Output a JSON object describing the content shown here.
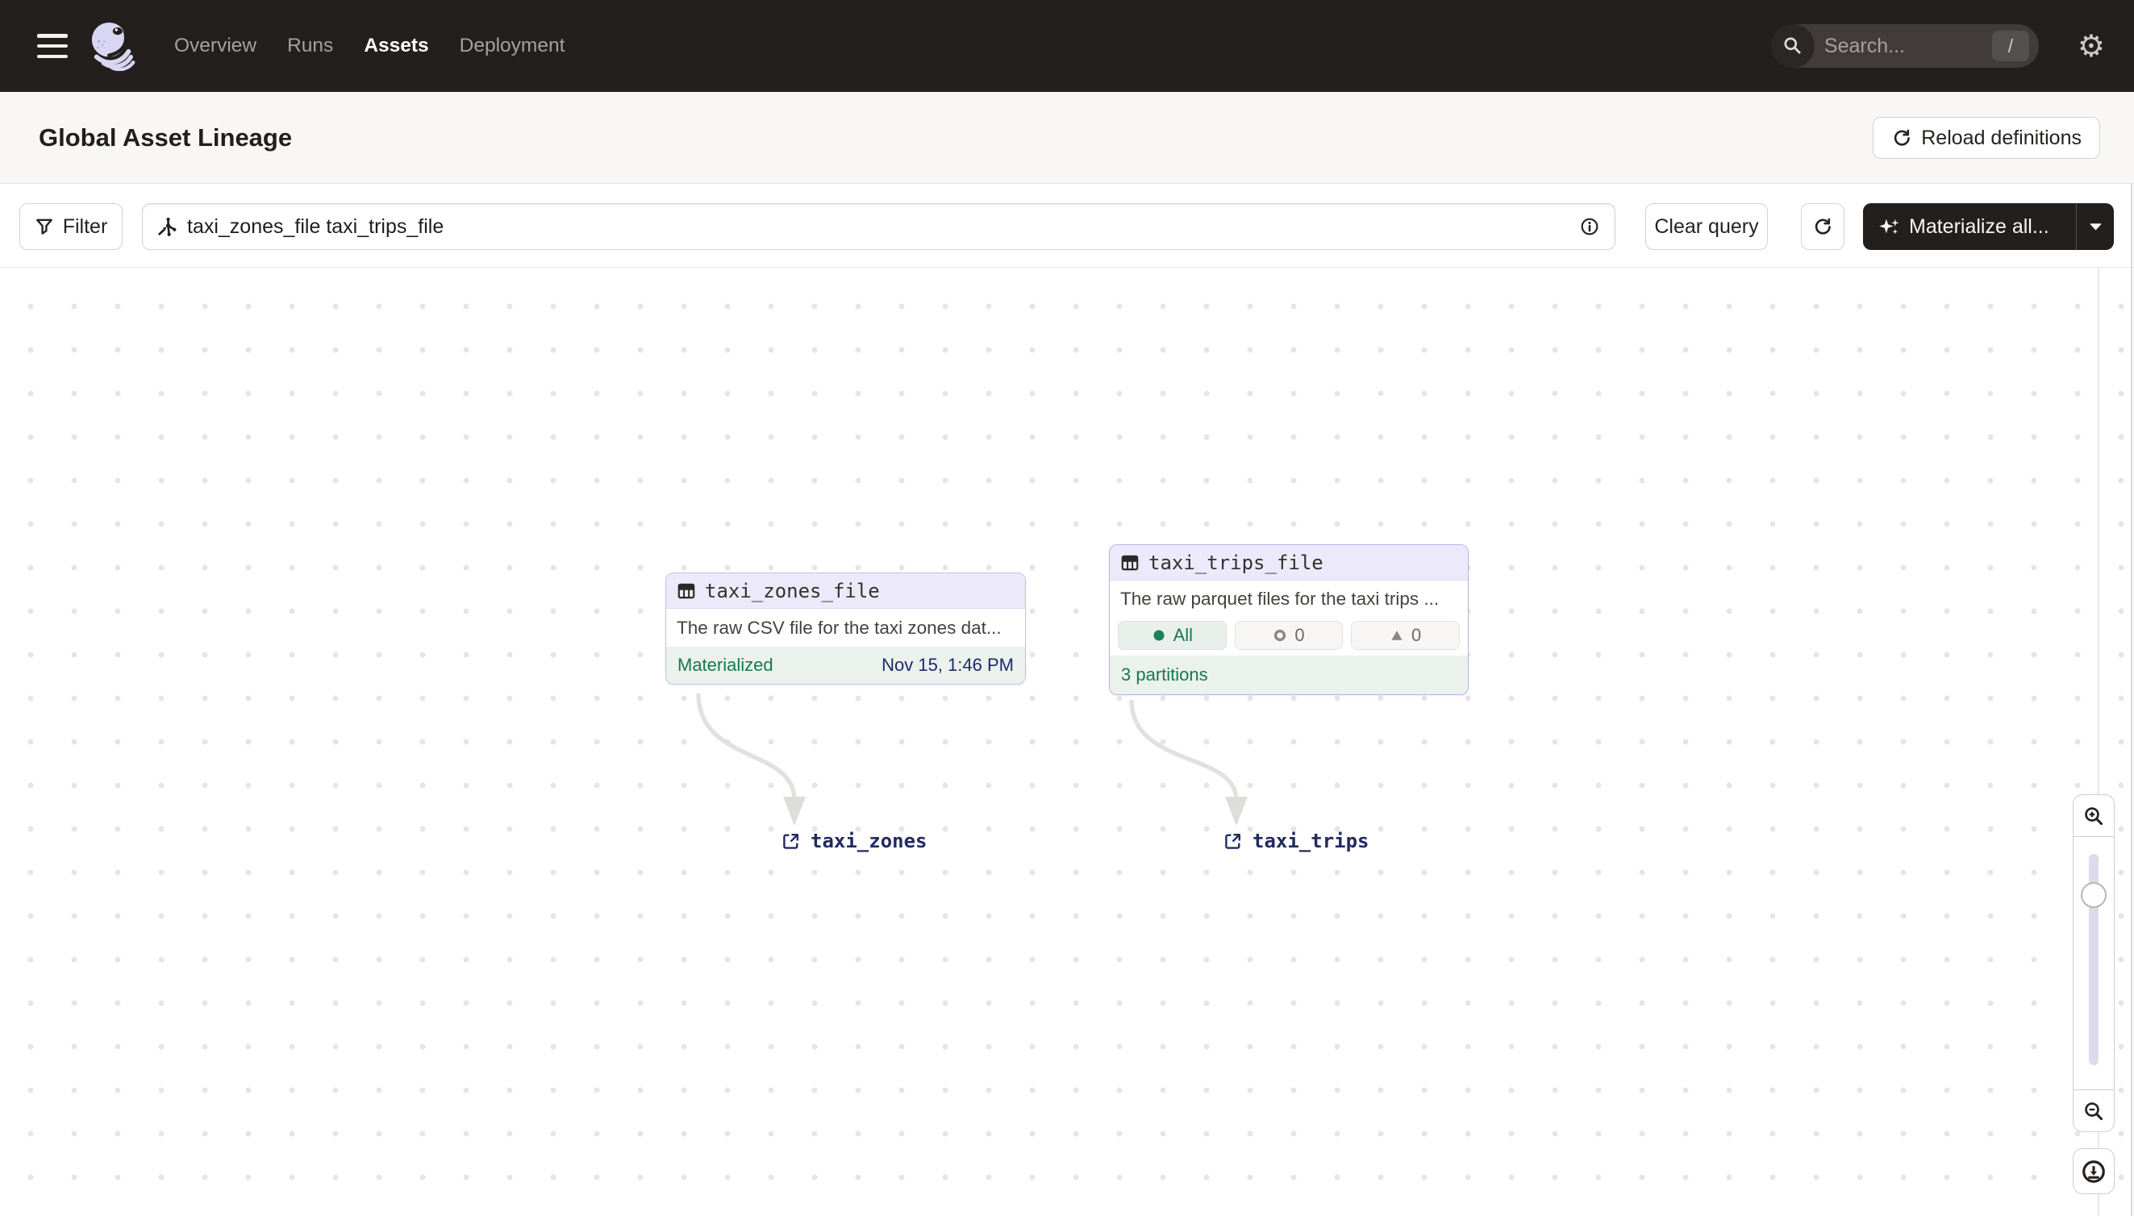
{
  "nav": {
    "items": [
      {
        "label": "Overview",
        "active": false
      },
      {
        "label": "Runs",
        "active": false
      },
      {
        "label": "Assets",
        "active": true
      },
      {
        "label": "Deployment",
        "active": false
      }
    ],
    "search": {
      "placeholder": "Search...",
      "shortcut_key": "/"
    }
  },
  "page_header": {
    "title": "Global Asset Lineage",
    "reload_button": "Reload definitions"
  },
  "toolbar": {
    "filter_button": "Filter",
    "query_value": "taxi_zones_file taxi_trips_file",
    "clear_button": "Clear query",
    "materialize_button": "Materialize all..."
  },
  "graph": {
    "nodes": [
      {
        "title": "taxi_zones_file",
        "description": "The raw CSV file for the taxi zones dat...",
        "status_label": "Materialized",
        "status_time": "Nov 15, 1:46 PM"
      },
      {
        "title": "taxi_trips_file",
        "description": "The raw parquet files for the taxi trips ...",
        "badges": [
          {
            "icon": "dot",
            "label": "All"
          },
          {
            "icon": "ring",
            "label": "0"
          },
          {
            "icon": "triangle",
            "label": "0"
          }
        ],
        "footer": "3 partitions"
      }
    ],
    "links": [
      {
        "label": "taxi_zones"
      },
      {
        "label": "taxi_trips"
      }
    ]
  },
  "colors": {
    "nav_bg": "#231F1D",
    "node_header_lavender": "#ECEAFA",
    "node_border": "#C2BDEE",
    "status_green": "#15794F",
    "status_green_bg": "#EBF1ED",
    "timestamp_navy": "#1E2B66",
    "link_navy": "#222A60"
  }
}
